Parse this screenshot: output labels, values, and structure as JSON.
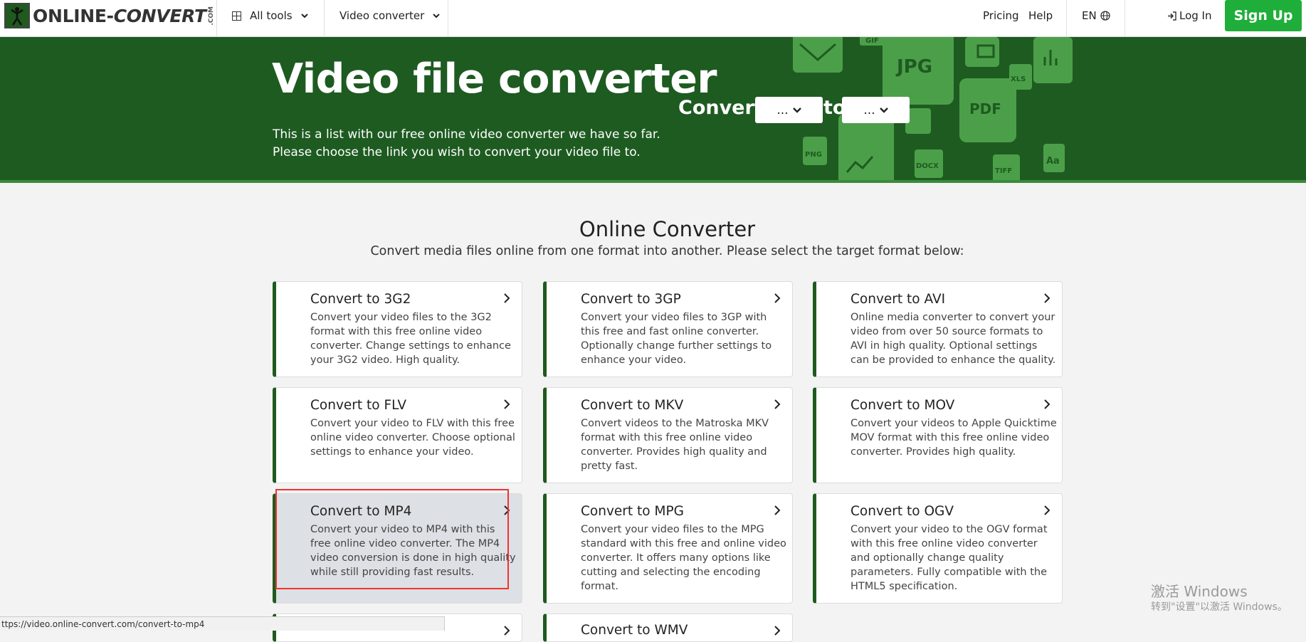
{
  "header": {
    "logo_text_main": "ONLINE-",
    "logo_text_italic": "CONVERT",
    "logo_com": ".COM",
    "nav": {
      "all_tools": "All tools",
      "video_converter": "Video converter",
      "pricing": "Pricing",
      "help": "Help",
      "lang": "EN",
      "login": "Log In",
      "signup": "Sign Up"
    }
  },
  "hero": {
    "title": "Video file converter",
    "subtitle_line1": "This is a list with our free online video converter we have so far.",
    "subtitle_line2": "Please choose the link you wish to convert your video file to.",
    "convert_label": "Convert",
    "to_label": "to",
    "from_select": "...",
    "to_select": "...",
    "deco_labels": [
      "GIF",
      "JPG",
      "XLS",
      "PDF",
      "PNG",
      "DOCX",
      "TIFF",
      "Aa"
    ]
  },
  "section": {
    "title": "Online Converter",
    "subtitle": "Convert media files online from one format into another. Please select the target format below:"
  },
  "cards": [
    {
      "title": "Convert to 3G2",
      "desc": "Convert your video files to the 3G2 format with this free online video converter. Change settings to enhance your 3G2 video. High quality."
    },
    {
      "title": "Convert to 3GP",
      "desc": "Convert your video files to 3GP with this free and fast online converter. Optionally change further settings to enhance your video."
    },
    {
      "title": "Convert to AVI",
      "desc": "Online media converter to convert your video from over 50 source formats to AVI in high quality. Optional settings can be provided to enhance the quality."
    },
    {
      "title": "Convert to FLV",
      "desc": "Convert your video to FLV with this free online video converter. Choose optional settings to enhance your video."
    },
    {
      "title": "Convert to MKV",
      "desc": "Convert videos to the Matroska MKV format with this free online video converter. Provides high quality and pretty fast."
    },
    {
      "title": "Convert to MOV",
      "desc": "Convert your videos to Apple Quicktime MOV format with this free online video converter. Provides high quality."
    },
    {
      "title": "Convert to MP4",
      "desc": "Convert your video to MP4 with this free online video converter. The MP4 video conversion is done in high quality while still providing fast results."
    },
    {
      "title": "Convert to MPG",
      "desc": "Convert your video files to the MPG standard with this free and online video converter. It offers many options like cutting and selecting the encoding format."
    },
    {
      "title": "Convert to OGV",
      "desc": "Convert your video to the OGV format with this free online video converter and optionally change quality parameters. Fully compatible with the HTML5 specification."
    },
    {
      "title": "",
      "desc": ""
    },
    {
      "title": "Convert to WMV",
      "desc": ""
    }
  ],
  "status_url": "ttps://video.online-convert.com/convert-to-mp4",
  "watermark": {
    "line1": "激活 Windows",
    "line2": "转到\"设置\"以激活 Windows。"
  },
  "colors": {
    "hero_bg": "#1e5b21",
    "accent_green": "#1fae3a",
    "card_border_left": "#1f5a1f",
    "highlight_red": "#e33333"
  }
}
